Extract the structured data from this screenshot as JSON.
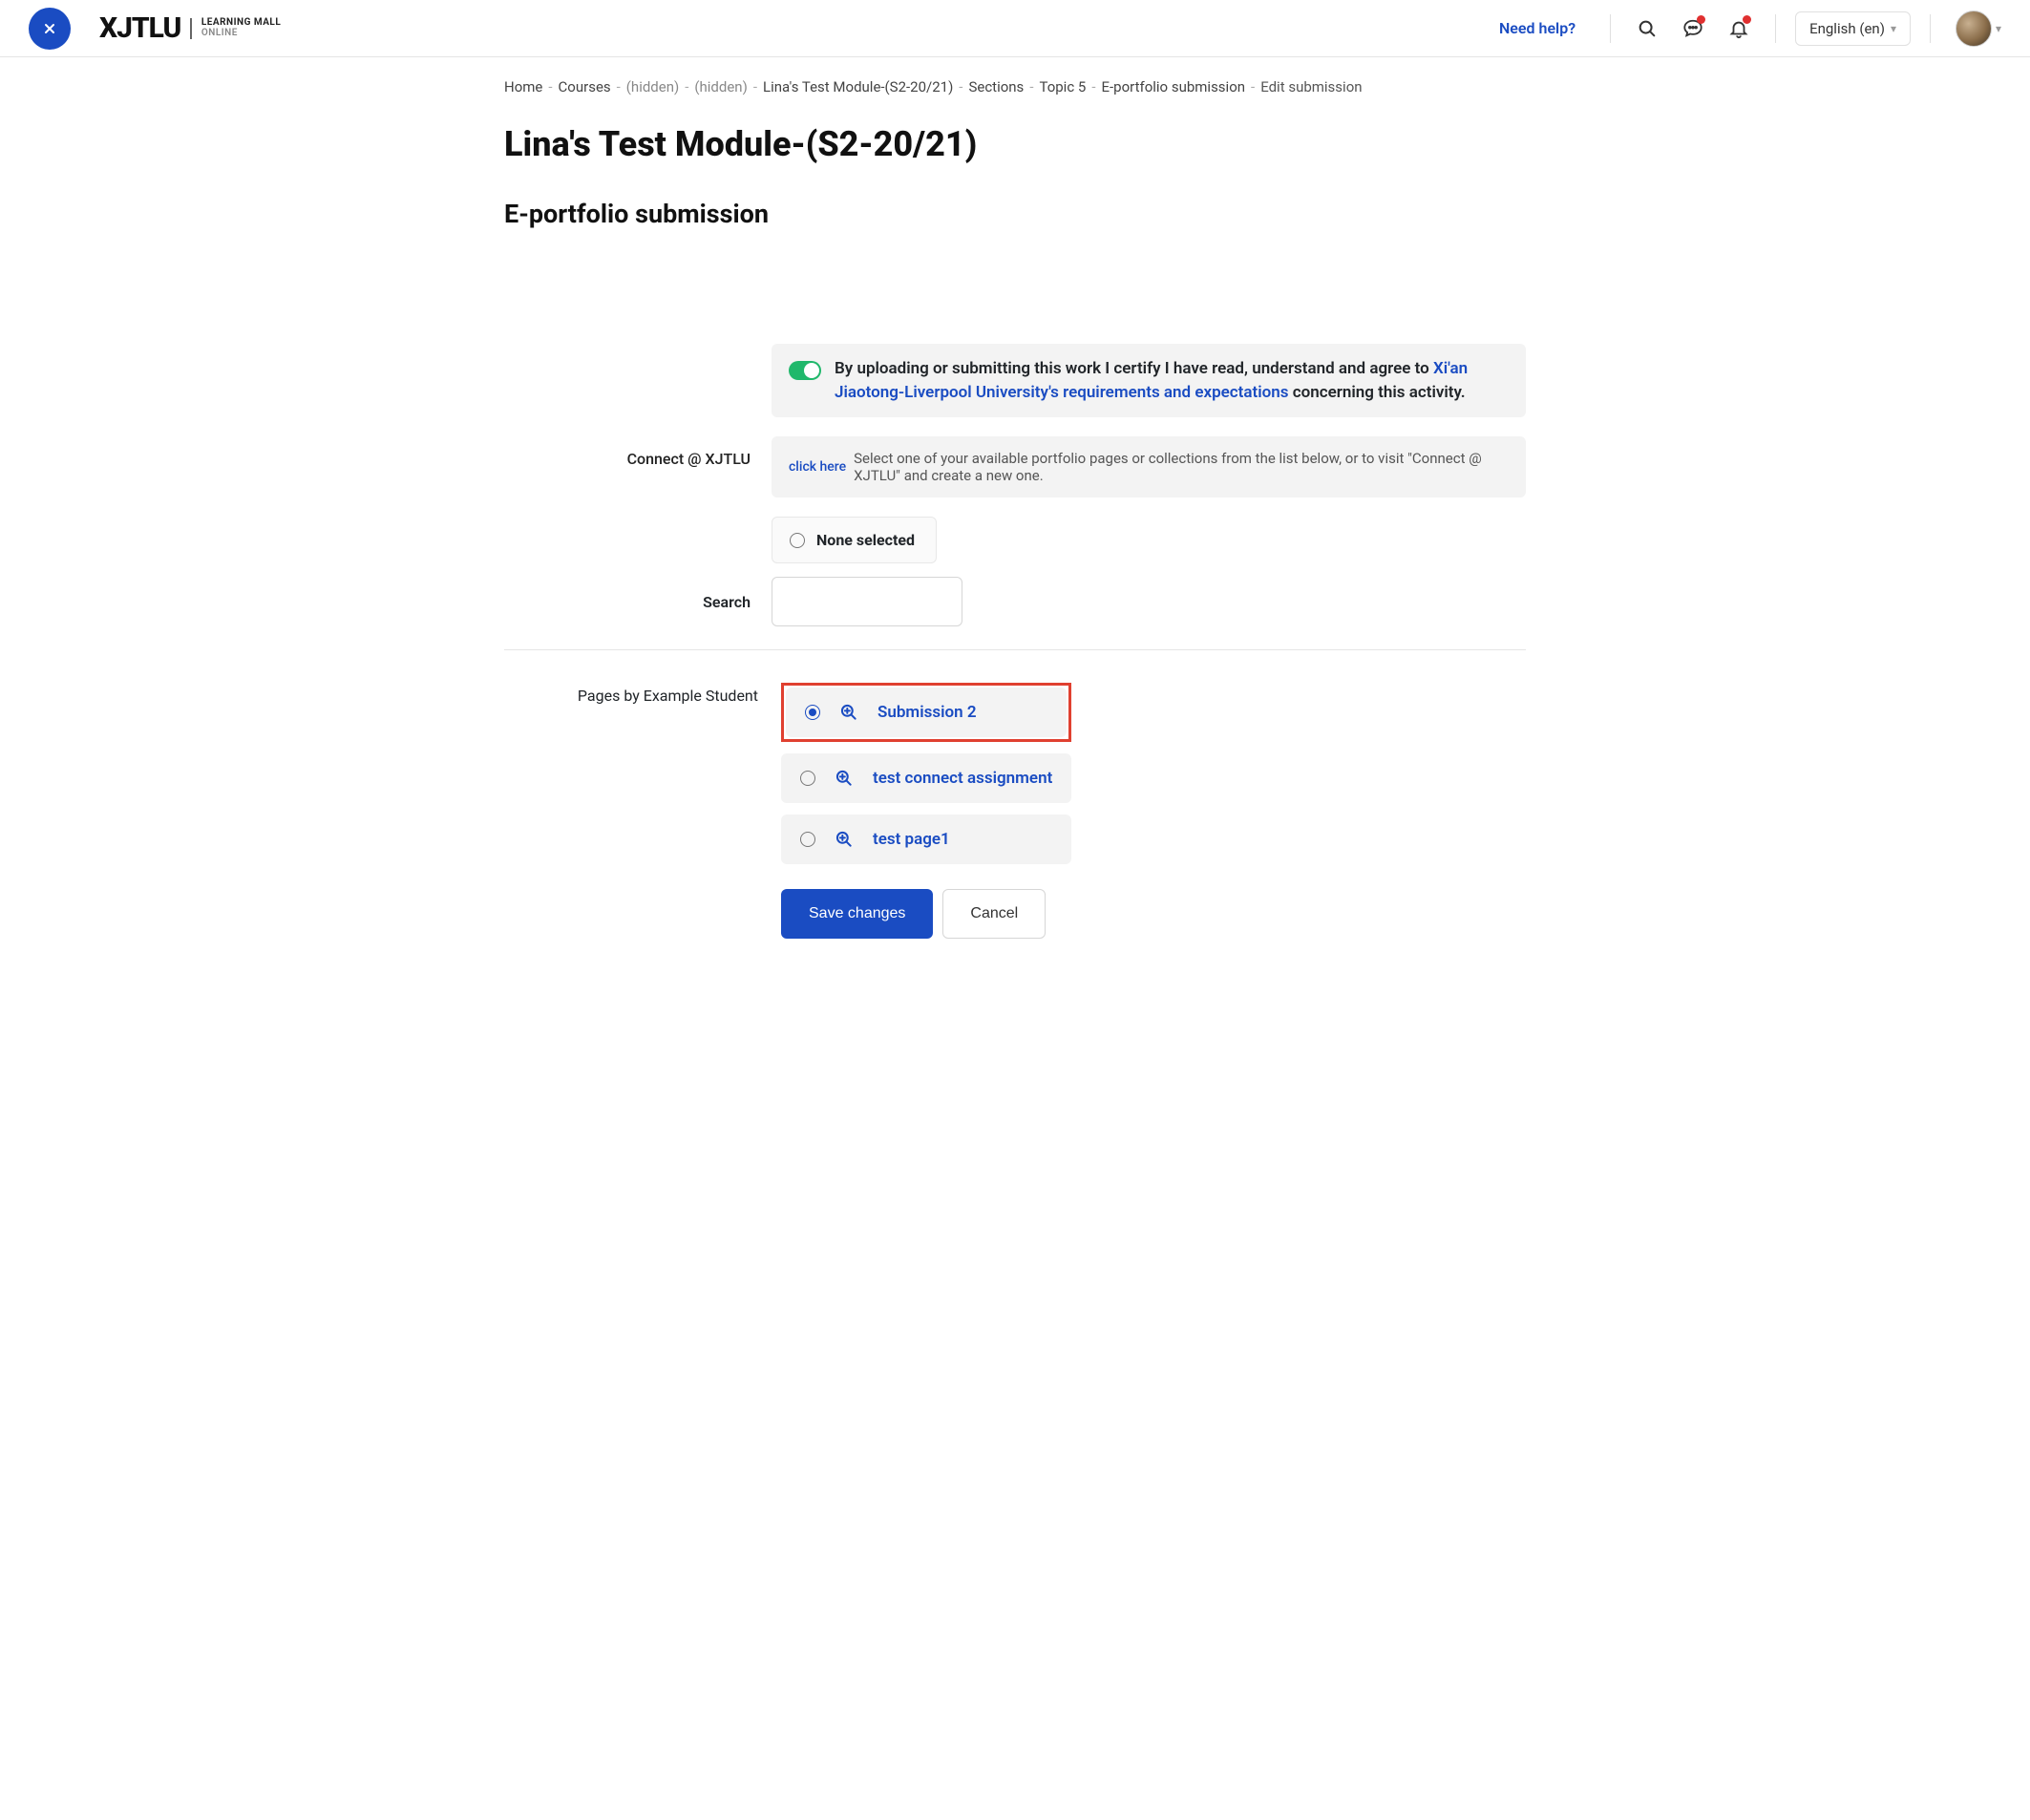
{
  "header": {
    "logo_main": "XJTLU",
    "logo_sub1": "LEARNING MALL",
    "logo_sub2": "ONLINE",
    "help": "Need help?",
    "language": "English (en)"
  },
  "breadcrumb": {
    "items": [
      {
        "label": "Home",
        "type": "link"
      },
      {
        "label": "Courses",
        "type": "link"
      },
      {
        "label": "(hidden)",
        "type": "hidden"
      },
      {
        "label": "(hidden)",
        "type": "hidden"
      },
      {
        "label": "Lina's Test Module-(S2-20/21)",
        "type": "link"
      },
      {
        "label": "Sections",
        "type": "link"
      },
      {
        "label": "Topic 5",
        "type": "link"
      },
      {
        "label": "E-portfolio submission",
        "type": "link"
      },
      {
        "label": "Edit submission",
        "type": "current"
      }
    ]
  },
  "page": {
    "title": "Lina's Test Module-(S2-20/21)",
    "activity": "E-portfolio submission"
  },
  "certify": {
    "text_before": "By uploading or submitting this work I certify I have read, understand and agree to ",
    "link": "Xi'an Jiaotong-Liverpool University's requirements and expectations",
    "text_after": " concerning this activity."
  },
  "connect": {
    "label": "Connect @ XJTLU",
    "click_here": "click here",
    "desc": "Select one of your available portfolio pages or collections from the list below, or to visit \"Connect @ XJTLU\" and create a new one."
  },
  "none_selected": "None selected",
  "search_label": "Search",
  "pages": {
    "heading": "Pages by Example Student",
    "items": [
      {
        "title": "Submission 2",
        "selected": true,
        "highlighted": true
      },
      {
        "title": "test connect assignment",
        "selected": false,
        "highlighted": false
      },
      {
        "title": "test page1",
        "selected": false,
        "highlighted": false
      }
    ]
  },
  "buttons": {
    "save": "Save changes",
    "cancel": "Cancel"
  }
}
